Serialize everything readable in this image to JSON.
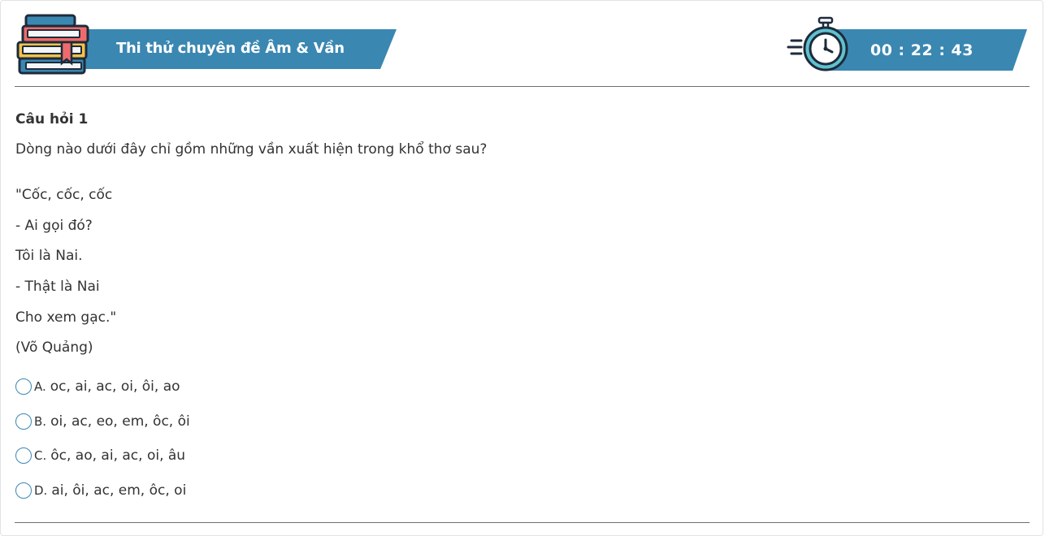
{
  "header": {
    "title": "Thi thử chuyên đề Âm & Vần",
    "timer": "00 : 22 : 43"
  },
  "question": {
    "number_label": "Câu hỏi 1",
    "prompt": "Dòng nào dưới đây chỉ gồm những vần xuất hiện trong khổ thơ sau?",
    "poem_lines": [
      "\"Cốc, cốc, cốc",
      "- Ai gọi đó?",
      "Tôi là Nai.",
      "- Thật là Nai",
      "Cho xem gạc.\"",
      "(Võ Quảng)"
    ],
    "options": [
      {
        "letter": "A.",
        "text": "oc, ai, ac, oi, ôi, ao"
      },
      {
        "letter": "B.",
        "text": "oi, ac, eo, em, ôc, ôi"
      },
      {
        "letter": "C.",
        "text": "ôc, ao, ai, ac, oi, âu"
      },
      {
        "letter": "D.",
        "text": "ai, ôi, ac, em, ôc, oi"
      }
    ]
  },
  "colors": {
    "accent": "#3a87b2",
    "text": "#333333",
    "divider": "#6f6f6f"
  },
  "icons": {
    "header_left": "books-stack-icon",
    "header_right": "stopwatch-icon",
    "option_marker": "radio-circle-icon"
  }
}
